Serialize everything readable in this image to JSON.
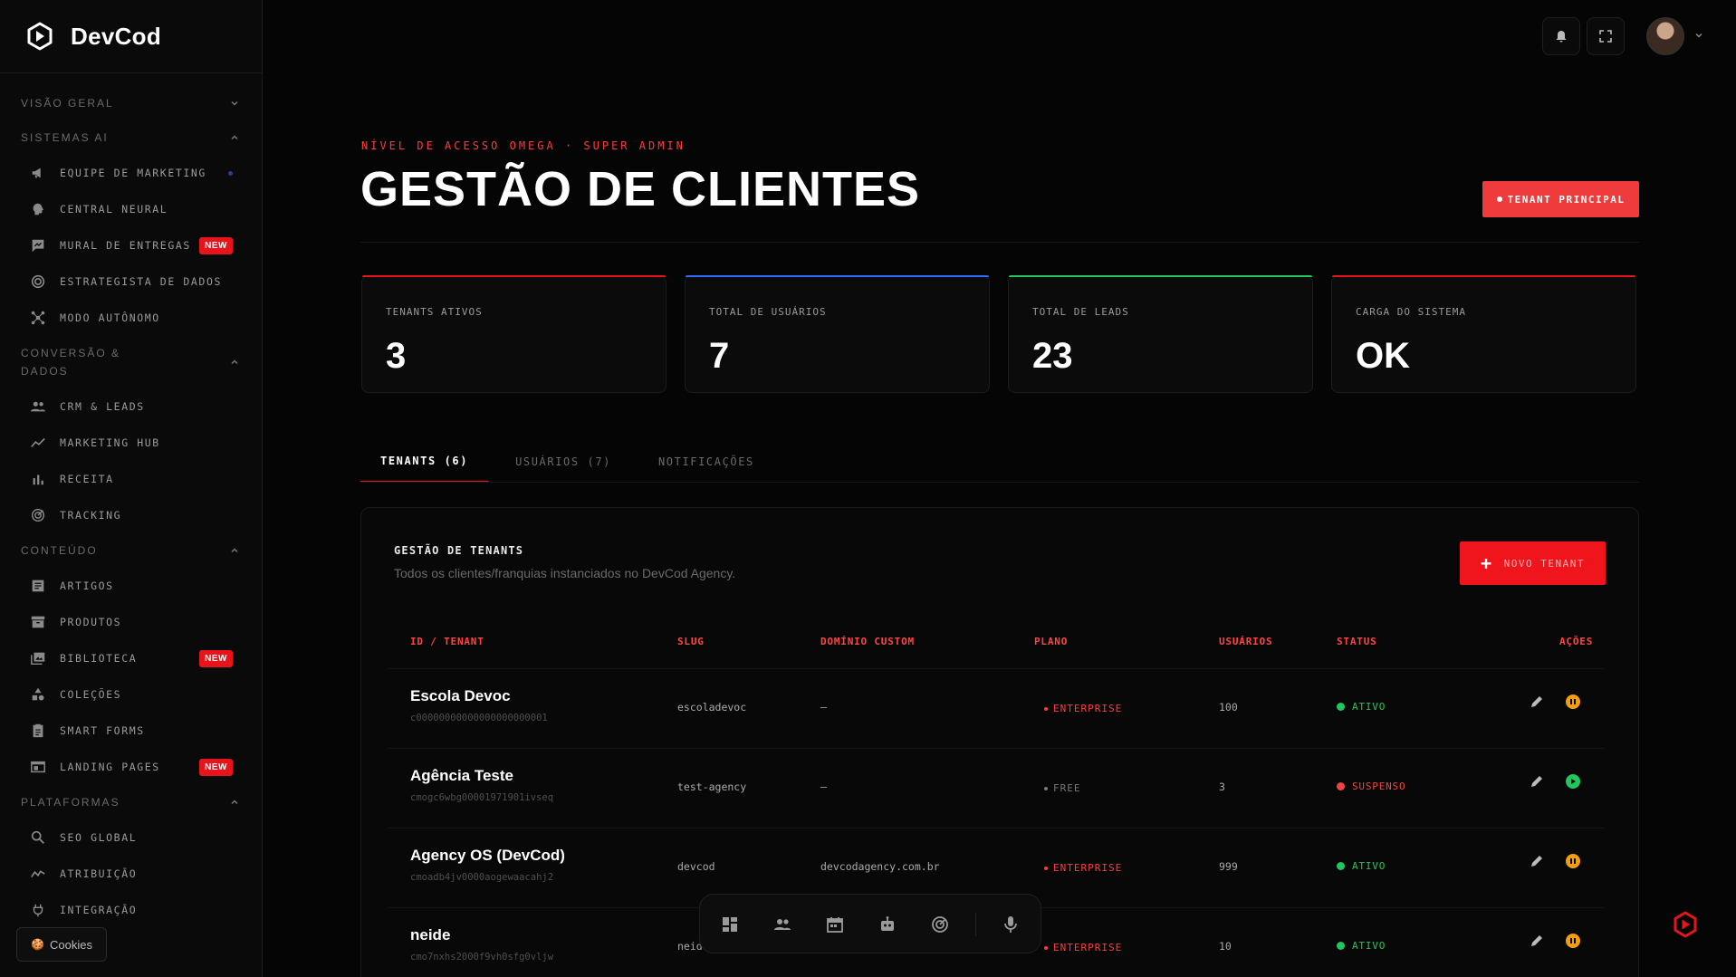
{
  "brand": {
    "name": "DevCod"
  },
  "sidebar": {
    "sections": [
      {
        "label": "VISÃO GERAL",
        "expanded": false,
        "items": []
      },
      {
        "label": "SISTEMAS AI",
        "expanded": true,
        "items": [
          {
            "label": "EQUIPE DE MARKETING",
            "icon": "megaphone-icon"
          },
          {
            "label": "CENTRAL NEURAL",
            "icon": "brain-icon"
          },
          {
            "label": "MURAL DE ENTREGAS",
            "icon": "chat-icon",
            "badge": "NEW"
          },
          {
            "label": "ESTRATEGISTA DE DADOS",
            "icon": "target-icon"
          },
          {
            "label": "MODO AUTÔNOMO",
            "icon": "network-icon"
          }
        ]
      },
      {
        "label": "CONVERSÃO & DADOS",
        "expanded": true,
        "items": [
          {
            "label": "CRM & LEADS",
            "icon": "people-icon"
          },
          {
            "label": "MARKETING HUB",
            "icon": "trend-icon"
          },
          {
            "label": "RECEITA",
            "icon": "bar-chart-icon"
          },
          {
            "label": "TRACKING",
            "icon": "radar-icon"
          }
        ]
      },
      {
        "label": "CONTEÚDO",
        "expanded": true,
        "items": [
          {
            "label": "ARTIGOS",
            "icon": "article-icon"
          },
          {
            "label": "PRODUTOS",
            "icon": "archive-icon"
          },
          {
            "label": "BIBLIOTECA",
            "icon": "library-icon",
            "badge": "NEW"
          },
          {
            "label": "COLEÇÕES",
            "icon": "shapes-icon"
          },
          {
            "label": "SMART FORMS",
            "icon": "form-icon"
          },
          {
            "label": "LANDING PAGES",
            "icon": "browser-icon",
            "badge": "NEW"
          }
        ]
      },
      {
        "label": "PLATAFORMAS",
        "expanded": true,
        "items": [
          {
            "label": "SEO GLOBAL",
            "icon": "search-icon"
          },
          {
            "label": "ATRIBUIÇÃO",
            "icon": "trend-icon"
          },
          {
            "label": "INTEGRAÇÃO",
            "icon": "plug-icon"
          }
        ]
      }
    ],
    "cookies_label": "Cookies"
  },
  "header": {
    "access_level": "NÍVEL DE ACESSO OMEGA · SUPER ADMIN",
    "title": "GESTÃO DE CLIENTES",
    "tenant_button": "TENANT PRINCIPAL"
  },
  "stats": [
    {
      "label": "TENANTS ATIVOS",
      "value": "3",
      "color": "#e8141c"
    },
    {
      "label": "TOTAL DE USUÁRIOS",
      "value": "7",
      "color": "#2f6bff"
    },
    {
      "label": "TOTAL DE LEADS",
      "value": "23",
      "color": "#22c55e"
    },
    {
      "label": "CARGA DO SISTEMA",
      "value": "OK",
      "color": "#e8141c"
    }
  ],
  "tabs": [
    {
      "label": "TENANTS (6)",
      "active": true
    },
    {
      "label": "USUÁRIOS (7)",
      "active": false
    },
    {
      "label": "NOTIFICAÇÕES",
      "active": false
    }
  ],
  "panel": {
    "title": "GESTÃO DE TENANTS",
    "subtitle": "Todos os clientes/franquias instanciados no DevCod Agency.",
    "new_button": "NOVO TENANT",
    "columns": [
      "ID / TENANT",
      "SLUG",
      "DOMÍNIO CUSTOM",
      "PLANO",
      "USUÁRIOS",
      "STATUS",
      "AÇÕES"
    ],
    "rows": [
      {
        "name": "Escola Devoc",
        "id": "c00000000000000000000001",
        "slug": "escoladevoc",
        "domain": "—",
        "plan": "ENTERPRISE",
        "users": "100",
        "status": "ATIVO"
      },
      {
        "name": "Agência Teste",
        "id": "cmogc6wbg00001971901ivseq",
        "slug": "test-agency",
        "domain": "—",
        "plan": "FREE",
        "users": "3",
        "status": "SUSPENSO"
      },
      {
        "name": "Agency OS (DevCod)",
        "id": "cmoadb4jv0000aogewaacahj2",
        "slug": "devcod",
        "domain": "devcodagency.com.br",
        "plan": "ENTERPRISE",
        "users": "999",
        "status": "ATIVO"
      },
      {
        "name": "neide",
        "id": "cmo7nxhs2000f9vh0sfg0vljw",
        "slug": "neide",
        "domain": "",
        "plan": "ENTERPRISE",
        "users": "10",
        "status": "ATIVO"
      }
    ]
  },
  "colors": {
    "accent": "#e8141c",
    "active": "#22c55e",
    "suspended": "#ef4444",
    "pause": "#f59e0b"
  }
}
